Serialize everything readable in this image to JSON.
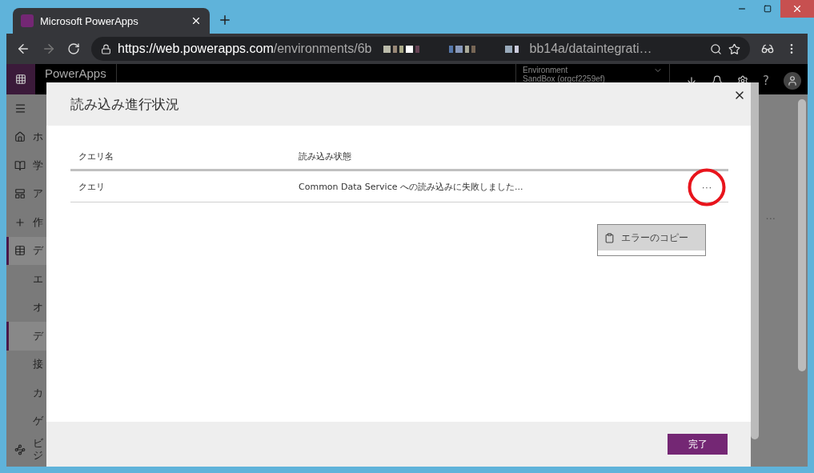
{
  "browser": {
    "tab": {
      "title": "Microsoft PowerApps",
      "selected": true
    },
    "address_bar": {
      "url_host": "https://web.powerapps.com",
      "url_path": "/environments/6b",
      "url_end": "bb14a/dataintegrati…"
    }
  },
  "app_header": {
    "title": "PowerApps",
    "environment_label": "Environment",
    "environment_name": "SandBox (orgcf2259ef)",
    "help": "?"
  },
  "sidebar": {
    "items": [
      {
        "label": "ホ",
        "selected": false
      },
      {
        "label": "学",
        "selected": false
      },
      {
        "label": "ア",
        "selected": false
      },
      {
        "label": "作",
        "selected": false
      },
      {
        "label": "デ",
        "selected": true
      },
      {
        "label": "エ",
        "selected": false
      },
      {
        "label": "オ",
        "selected": false
      },
      {
        "label": "デ",
        "selected": true
      },
      {
        "label": "接",
        "selected": false
      },
      {
        "label": "カ",
        "selected": false
      },
      {
        "label": "ゲ",
        "selected": false
      },
      {
        "label": "ビジ",
        "selected": false
      }
    ]
  },
  "background": {
    "row_more": "···"
  },
  "dialog": {
    "title": "読み込み進行状況",
    "columns": [
      "クエリ名",
      "読み込み状態"
    ],
    "rows": [
      {
        "cells": [
          "クエリ",
          "Common Data Service への読み込みに失敗しました..."
        ],
        "more": "···",
        "highlighted": true
      }
    ],
    "context_menu": {
      "items": [
        {
          "label": "エラーのコピー"
        }
      ]
    },
    "footer_button": "完了"
  }
}
